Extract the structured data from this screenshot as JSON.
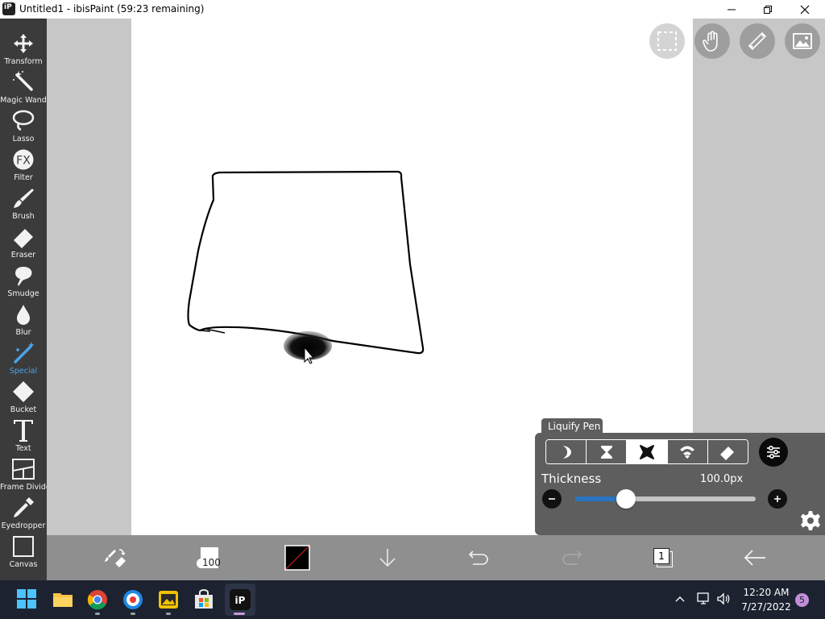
{
  "window": {
    "title": "Untitled1 - ibisPaint (59:23 remaining)",
    "controls": [
      "minimize",
      "restore",
      "close"
    ]
  },
  "toolbar": {
    "tools": [
      {
        "label": "Transform",
        "icon": "transform-arrows-icon"
      },
      {
        "label": "Magic Wand",
        "icon": "magic-wand-icon"
      },
      {
        "label": "Lasso",
        "icon": "lasso-icon"
      },
      {
        "label": "Filter",
        "icon": "fx-filter-icon"
      },
      {
        "label": "Brush",
        "icon": "brush-icon"
      },
      {
        "label": "Eraser",
        "icon": "eraser-icon"
      },
      {
        "label": "Smudge",
        "icon": "smudge-icon"
      },
      {
        "label": "Blur",
        "icon": "blur-drop-icon"
      },
      {
        "label": "Special",
        "icon": "special-pen-icon",
        "active": true
      },
      {
        "label": "Bucket",
        "icon": "bucket-icon"
      },
      {
        "label": "Text",
        "icon": "text-icon"
      },
      {
        "label": "Frame Divider",
        "icon": "frame-divider-icon"
      },
      {
        "label": "Eyedropper",
        "icon": "eyedropper-icon"
      },
      {
        "label": "Canvas",
        "icon": "canvas-icon"
      }
    ],
    "active_color": "#4aa3ea"
  },
  "top_buttons": [
    "selection-icon",
    "hand-icon",
    "ruler-icon",
    "image-material-icon"
  ],
  "liquify": {
    "panel_title": "Liquify Pen",
    "modes": [
      "push-mode-icon",
      "pinch-mode-icon",
      "expand-mode-icon",
      "twirl-mode-icon",
      "restore-eraser-icon"
    ],
    "selected_mode": 2,
    "thickness_label": "Thickness",
    "thickness_value": "100.0px",
    "thickness_level": 0.28
  },
  "bottombar": {
    "brush_size": "100",
    "color": "#000000",
    "layers_count": "1",
    "icons": [
      "brush-eraser-swap-icon",
      "brush-size-icon",
      "color-swatch-icon",
      "download-icon",
      "undo-icon",
      "redo-icon",
      "layers-icon",
      "back-icon"
    ]
  },
  "taskbar": {
    "apps": [
      "windows-start-icon",
      "file-explorer-icon",
      "chrome-icon",
      "browser-icon",
      "photo-app-icon",
      "store-icon",
      "ibispaint-icon"
    ],
    "time": "12:20 AM",
    "date": "7/27/2022",
    "notifications": "5",
    "accent": "#1c2230"
  }
}
